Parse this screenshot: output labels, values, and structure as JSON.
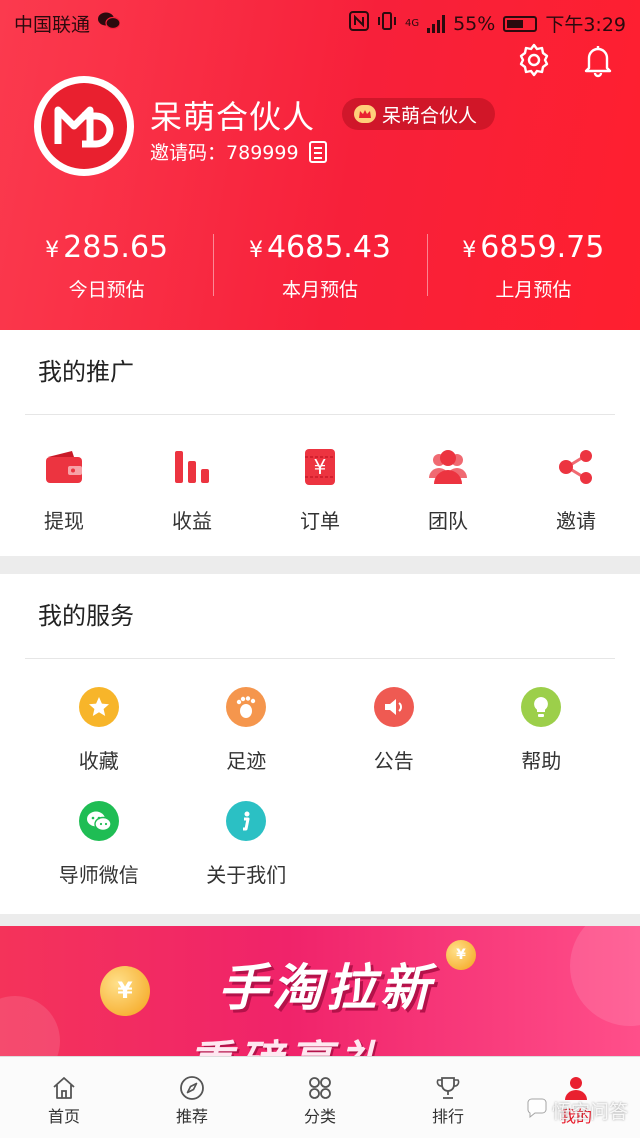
{
  "status_bar": {
    "carrier": "中国联通",
    "battery_percent": "55%",
    "time": "下午3:29",
    "network": "4G"
  },
  "header": {
    "username": "呆萌合伙人",
    "badge": "呆萌合伙人",
    "invite_label": "邀请码：",
    "invite_code": "789999",
    "stats": [
      {
        "value": "285.65",
        "currency": "¥",
        "label": "今日预估"
      },
      {
        "value": "4685.43",
        "currency": "¥",
        "label": "本月预估"
      },
      {
        "value": "6859.75",
        "currency": "¥",
        "label": "上月预估"
      }
    ]
  },
  "promotion": {
    "title": "我的推广",
    "items": [
      {
        "label": "提现",
        "icon": "wallet-icon"
      },
      {
        "label": "收益",
        "icon": "bar-chart-icon"
      },
      {
        "label": "订单",
        "icon": "order-icon"
      },
      {
        "label": "团队",
        "icon": "team-icon"
      },
      {
        "label": "邀请",
        "icon": "share-icon"
      }
    ]
  },
  "services": {
    "title": "我的服务",
    "items": [
      {
        "label": "收藏",
        "icon": "star-icon",
        "color": "#f7b52a"
      },
      {
        "label": "足迹",
        "icon": "footprint-icon",
        "color": "#f5964d"
      },
      {
        "label": "公告",
        "icon": "speaker-icon",
        "color": "#ef5a52"
      },
      {
        "label": "帮助",
        "icon": "lightbulb-icon",
        "color": "#9ccf4a"
      },
      {
        "label": "导师微信",
        "icon": "wechat-icon",
        "color": "#1fbd54"
      },
      {
        "label": "关于我们",
        "icon": "info-icon",
        "color": "#2bc0c4"
      }
    ]
  },
  "banner": {
    "line1": "手淘拉新",
    "line2": "重磅豪礼"
  },
  "bottom_nav": {
    "items": [
      {
        "label": "首页",
        "icon": "home-icon"
      },
      {
        "label": "推荐",
        "icon": "compass-icon"
      },
      {
        "label": "分类",
        "icon": "category-icon"
      },
      {
        "label": "排行",
        "icon": "trophy-icon"
      },
      {
        "label": "我的",
        "icon": "user-icon",
        "active": true
      }
    ]
  },
  "watermark": "悟空问答",
  "colors": {
    "brand_red": "#e9202f",
    "header_gradient_start": "#fb3a4e",
    "header_gradient_end": "#ff1f2f"
  }
}
